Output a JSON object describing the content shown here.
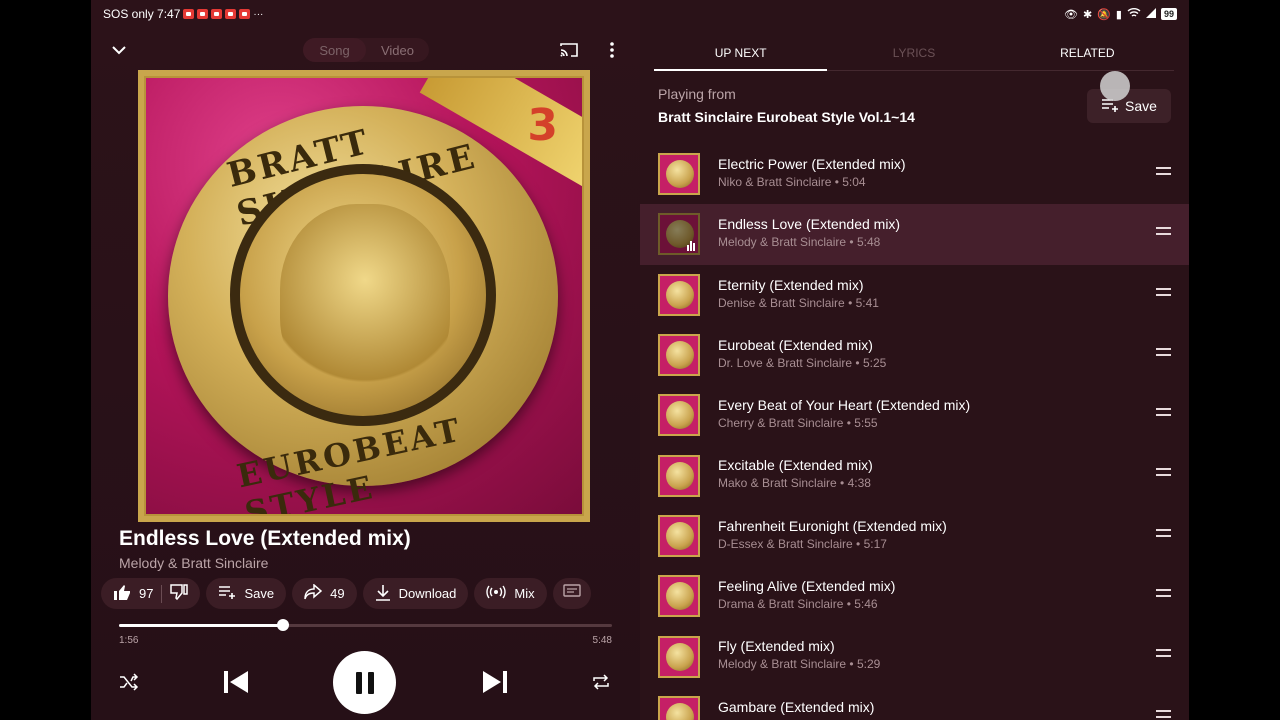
{
  "status": {
    "left_text": "SOS only 7:47",
    "battery": "99"
  },
  "player": {
    "mode_tabs": [
      "Song",
      "Video"
    ],
    "title": "Endless Love (Extended mix)",
    "artist": "Melody & Bratt Sinclaire",
    "likes": "97",
    "save_label": "Save",
    "shares": "49",
    "download_label": "Download",
    "mix_label": "Mix",
    "elapsed": "1:56",
    "duration": "5:48",
    "progress_fraction": 0.333
  },
  "cover": {
    "top_text": "BRATT SINCLAIRE",
    "bottom_text": "EUROBEAT STYLE",
    "volume_number": "3"
  },
  "panel": {
    "tabs": [
      "UP NEXT",
      "LYRICS",
      "RELATED"
    ],
    "playing_from_label": "Playing from",
    "playlist_name": "Bratt Sinclaire Eurobeat Style Vol.1~14",
    "save_label": "Save"
  },
  "queue": [
    {
      "title": "Electric Power (Extended mix)",
      "artist": "Niko & Bratt Sinclaire",
      "duration": "5:04"
    },
    {
      "title": "Endless Love (Extended mix)",
      "artist": "Melody & Bratt Sinclaire",
      "duration": "5:48"
    },
    {
      "title": "Eternity (Extended mix)",
      "artist": "Denise & Bratt Sinclaire",
      "duration": "5:41"
    },
    {
      "title": "Eurobeat (Extended mix)",
      "artist": "Dr. Love & Bratt Sinclaire",
      "duration": "5:25"
    },
    {
      "title": "Every Beat of Your Heart (Extended mix)",
      "artist": "Cherry & Bratt Sinclaire",
      "duration": "5:55"
    },
    {
      "title": "Excitable (Extended mix)",
      "artist": "Mako & Bratt Sinclaire",
      "duration": "4:38"
    },
    {
      "title": "Fahrenheit Euronight (Extended mix)",
      "artist": "D-Essex & Bratt Sinclaire",
      "duration": "5:17"
    },
    {
      "title": "Feeling Alive (Extended mix)",
      "artist": "Drama & Bratt Sinclaire",
      "duration": "5:46"
    },
    {
      "title": "Fly (Extended mix)",
      "artist": "Melody & Bratt Sinclaire",
      "duration": "5:29"
    },
    {
      "title": "Gambare (Extended mix)",
      "artist": "",
      "duration": ""
    }
  ],
  "current_index": 1,
  "colors": {
    "background": "#2a1118",
    "current_row": "#451f2c",
    "chip": "#3b1d25",
    "cover_pink": "#b4145a",
    "gold": "#c9a64c"
  },
  "icons": [
    "collapse-chevron-icon",
    "cast-icon",
    "more-vert-icon",
    "thumb-up-icon",
    "thumb-down-icon",
    "playlist-add-icon",
    "share-icon",
    "download-icon",
    "radio-mix-icon",
    "comment-icon",
    "shuffle-icon",
    "skip-previous-icon",
    "pause-icon",
    "skip-next-icon",
    "repeat-icon",
    "drag-handle-icon"
  ]
}
